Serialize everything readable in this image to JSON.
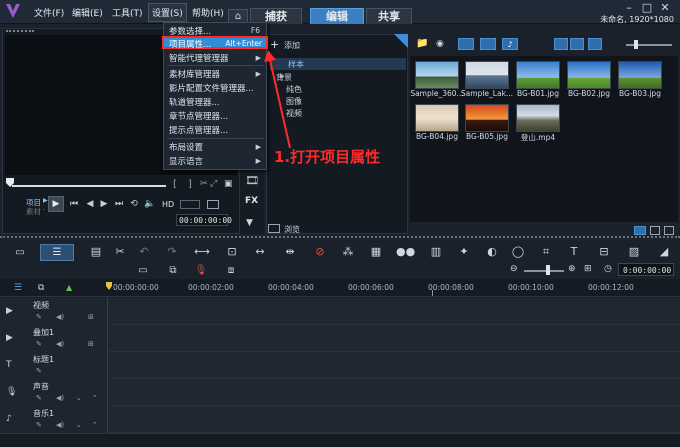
{
  "menubar": {
    "items": [
      "文件(F)",
      "编辑(E)",
      "工具(T)",
      "设置(S)",
      "帮助(H)"
    ]
  },
  "tabs": [
    "捕获",
    "编辑",
    "共享"
  ],
  "title_status": "未命名, 1920*1080",
  "settings_menu": {
    "items": [
      {
        "label": "参数选择...",
        "shortcut": "F6"
      },
      {
        "label": "项目属性...",
        "shortcut": "Alt+Enter"
      },
      {
        "label": "智能代理管理器",
        "submenu": true
      },
      {
        "label": "素材库管理器",
        "submenu": true
      },
      {
        "label": "影片配置文件管理器..."
      },
      {
        "label": "轨道管理器..."
      },
      {
        "label": "章节点管理器..."
      },
      {
        "label": "提示点管理器..."
      },
      {
        "label": "布局设置",
        "submenu": true
      },
      {
        "label": "显示语言",
        "submenu": true
      }
    ]
  },
  "annotation": "1.打开项目属性",
  "library": {
    "add_label": "添加",
    "tree": [
      "样本",
      "背景",
      "纯色",
      "图像",
      "视频"
    ],
    "browse_label": "浏览",
    "thumbnails": [
      {
        "label": "Sample_360..."
      },
      {
        "label": "Sample_Lak..."
      },
      {
        "label": "BG-B01.jpg"
      },
      {
        "label": "BG-B02.jpg"
      },
      {
        "label": "BG-B03.jpg"
      },
      {
        "label": "BG-B04.jpg"
      },
      {
        "label": "BG-B05.jpg"
      },
      {
        "label": "登山.mp4"
      }
    ]
  },
  "player": {
    "mode_project": "项目",
    "mode_clip": "素材",
    "hd_label": "HD",
    "timecode": "00:00:00:00",
    "fx_label": "FX"
  },
  "timeline": {
    "ruler": [
      "00:00:00:00",
      "00:00:02:00",
      "00:00:04:00",
      "00:00:06:00",
      "00:00:08:00",
      "00:00:10:00",
      "00:00:12:00"
    ],
    "zoom_timecode": "0:00:00:00",
    "tracks": [
      "视频",
      "叠加1",
      "标题1",
      "声音",
      "音乐1"
    ]
  },
  "colors": {
    "accent": "#3a7fc0",
    "annotation_red": "#ff2a2a",
    "highlight": "#2f8ed8"
  }
}
